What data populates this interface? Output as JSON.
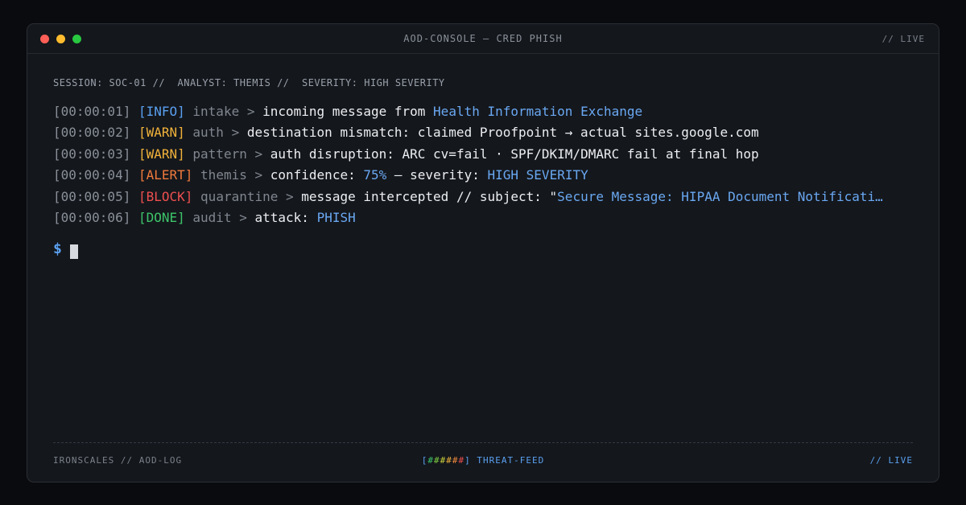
{
  "window": {
    "title": "AOD-CONSOLE — CRED PHISH",
    "status": "// LIVE",
    "colors": {
      "close": "#ff5f57",
      "minimize": "#febc2e",
      "maximize": "#28c840",
      "background": "#14171c",
      "accent": "#5aa0f0"
    }
  },
  "session_line": "SESSION: SOC-01 //  ANALYST: THEMIS //  SEVERITY: HIGH SEVERITY",
  "log": [
    {
      "ts": "[00:00:01]",
      "level": "[INFO]",
      "source": "intake >",
      "text": "incoming message from",
      "highlight": "Health Information Exchange",
      "text2": "",
      "highlight2": ""
    },
    {
      "ts": "[00:00:02]",
      "level": "[WARN]",
      "source": "auth >",
      "text": "destination mismatch: claimed Proofpoint → actual sites.google.com",
      "highlight": "",
      "text2": "",
      "highlight2": ""
    },
    {
      "ts": "[00:00:03]",
      "level": "[WARN]",
      "source": "pattern >",
      "text": "auth disruption: ARC cv=fail · SPF/DKIM/DMARC fail at final hop",
      "highlight": "",
      "text2": "",
      "highlight2": ""
    },
    {
      "ts": "[00:00:04]",
      "level": "[ALERT]",
      "source": "themis >",
      "text": "confidence:",
      "highlight": "75%",
      "text2": " — severity:",
      "highlight2": "HIGH SEVERITY"
    },
    {
      "ts": "[00:00:05]",
      "level": "[BLOCK]",
      "source": "quarantine >",
      "text": "message intercepted // subject: \"",
      "highlight": "Secure Message: HIPAA Document Notificati…",
      "text2": "",
      "highlight2": ""
    },
    {
      "ts": "[00:00:06]",
      "level": "[DONE]",
      "source": "audit >",
      "text": "attack:",
      "highlight": "PHISH",
      "text2": "",
      "highlight2": ""
    }
  ],
  "prompt": {
    "symbol": "$"
  },
  "footer": {
    "left": "IRONSCALES // AOD-LOG",
    "feed_open": "[",
    "feed_hashes": [
      "#",
      "#",
      "#",
      "#",
      "#",
      "#"
    ],
    "feed_close": "]",
    "feed_label": "THREAT-FEED",
    "right": "// LIVE"
  }
}
